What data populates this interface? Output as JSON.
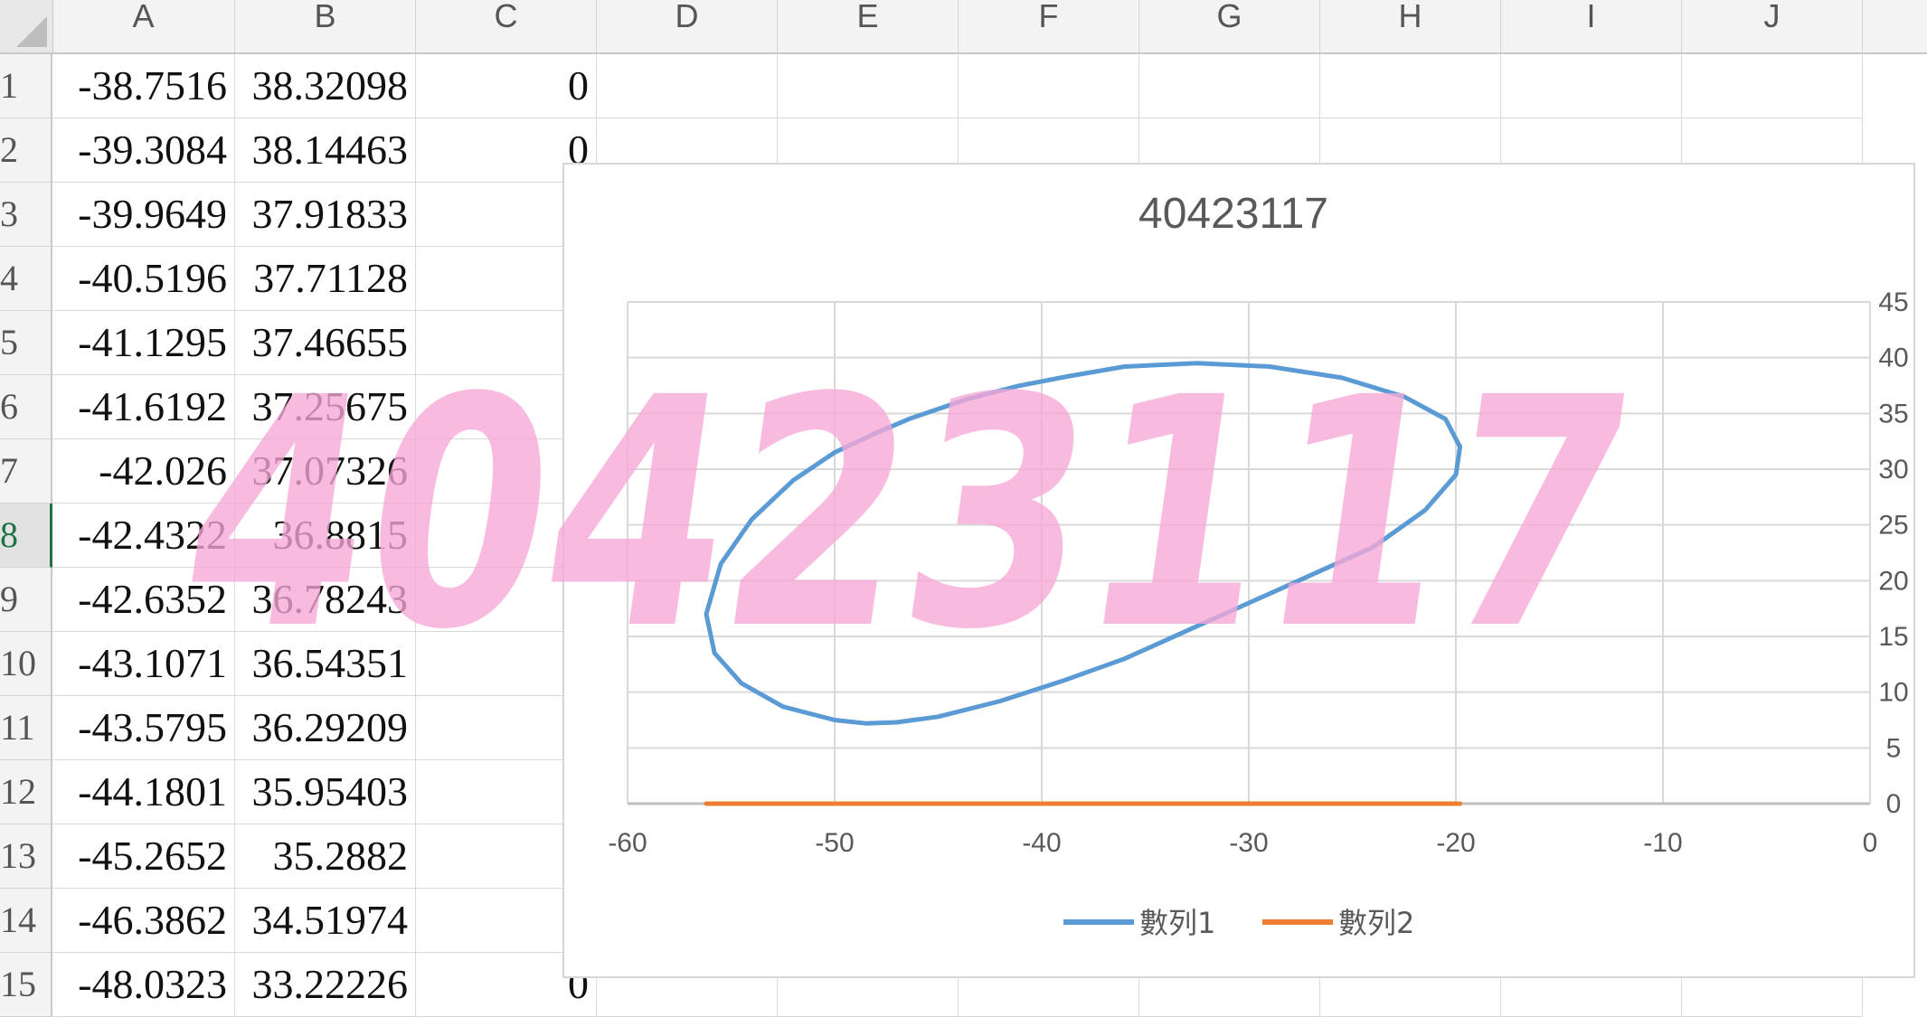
{
  "columns": [
    "A",
    "B",
    "C",
    "D",
    "E",
    "F",
    "G",
    "H",
    "I",
    "J"
  ],
  "rows": [
    {
      "num": "1",
      "a": "-38.7516",
      "b": "38.32098",
      "c": "0"
    },
    {
      "num": "2",
      "a": "-39.3084",
      "b": "38.14463",
      "c": "0"
    },
    {
      "num": "3",
      "a": "-39.9649",
      "b": "37.91833",
      "c": ""
    },
    {
      "num": "4",
      "a": "-40.5196",
      "b": "37.71128",
      "c": ""
    },
    {
      "num": "5",
      "a": "-41.1295",
      "b": "37.46655",
      "c": ""
    },
    {
      "num": "6",
      "a": "-41.6192",
      "b": "37.25675",
      "c": ""
    },
    {
      "num": "7",
      "a": "-42.026",
      "b": "37.07326",
      "c": ""
    },
    {
      "num": "8",
      "a": "-42.4322",
      "b": "36.8815",
      "c": ""
    },
    {
      "num": "9",
      "a": "-42.6352",
      "b": "36.78243",
      "c": ""
    },
    {
      "num": "10",
      "a": "-43.1071",
      "b": "36.54351",
      "c": ""
    },
    {
      "num": "11",
      "a": "-43.5795",
      "b": "36.29209",
      "c": ""
    },
    {
      "num": "12",
      "a": "-44.1801",
      "b": "35.95403",
      "c": ""
    },
    {
      "num": "13",
      "a": "-45.2652",
      "b": "35.2882",
      "c": ""
    },
    {
      "num": "14",
      "a": "-46.3862",
      "b": "34.51974",
      "c": ""
    },
    {
      "num": "15",
      "a": "-48.0323",
      "b": "33.22226",
      "c": "0"
    }
  ],
  "selected_row": "8",
  "watermark_text": "40423117",
  "colors": {
    "series1": "#5b9bd5",
    "series2": "#ed7d31",
    "watermark": "#f6a8d6",
    "grid": "#d9d9d9",
    "selected": "#217346"
  },
  "chart_data": {
    "type": "scatter",
    "title": "40423117",
    "xlim": [
      -60,
      0
    ],
    "ylim": [
      0,
      45
    ],
    "x_ticks": [
      "-60",
      "-50",
      "-40",
      "-30",
      "-20",
      "-10",
      "0"
    ],
    "y_ticks": [
      "45",
      "40",
      "35",
      "30",
      "25",
      "20",
      "15",
      "10",
      "5",
      "0"
    ],
    "y_axis_position": "right",
    "grid": true,
    "legend_position": "bottom",
    "series": [
      {
        "name": "數列1",
        "color": "#5b9bd5",
        "points": [
          [
            -19.8,
            32.0
          ],
          [
            -20.5,
            34.5
          ],
          [
            -22.5,
            36.5
          ],
          [
            -25.5,
            38.2
          ],
          [
            -29,
            39.2
          ],
          [
            -32.5,
            39.5
          ],
          [
            -36,
            39.2
          ],
          [
            -38.75,
            38.32
          ],
          [
            -41.13,
            37.47
          ],
          [
            -43.58,
            36.29
          ],
          [
            -46.39,
            34.52
          ],
          [
            -48.03,
            33.22
          ],
          [
            -50,
            31.5
          ],
          [
            -52,
            29
          ],
          [
            -54,
            25.5
          ],
          [
            -55.5,
            21.5
          ],
          [
            -56.2,
            17
          ],
          [
            -55.8,
            13.5
          ],
          [
            -54.5,
            10.8
          ],
          [
            -52.5,
            8.7
          ],
          [
            -50,
            7.5
          ],
          [
            -48.5,
            7.2
          ],
          [
            -47,
            7.3
          ],
          [
            -45,
            7.8
          ],
          [
            -42,
            9.2
          ],
          [
            -39,
            11
          ],
          [
            -36,
            13
          ],
          [
            -33,
            15.5
          ],
          [
            -30,
            18
          ],
          [
            -27,
            20.5
          ],
          [
            -24,
            23
          ],
          [
            -21.5,
            26.3
          ],
          [
            -20,
            29.5
          ],
          [
            -19.8,
            32.0
          ]
        ]
      },
      {
        "name": "數列2",
        "color": "#ed7d31",
        "points": [
          [
            -56.2,
            0
          ],
          [
            -19.8,
            0
          ]
        ]
      }
    ]
  }
}
